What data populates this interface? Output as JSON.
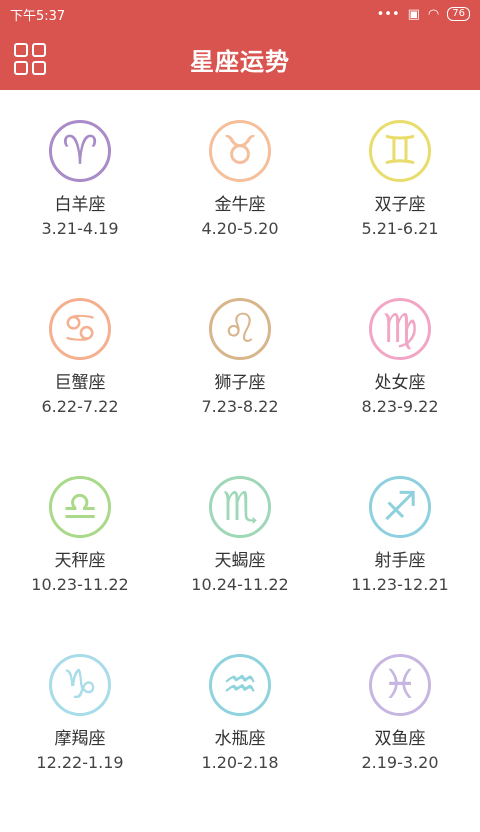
{
  "status": {
    "time": "下午5:37",
    "dots": "•••",
    "battery": "76"
  },
  "header": {
    "title": "星座运势",
    "menu_icon": "grid-menu-icon"
  },
  "signs": [
    {
      "name": "白羊座",
      "date": "3.21-4.19",
      "symbol": "♈",
      "color": "#a98bc7"
    },
    {
      "name": "金牛座",
      "date": "4.20-5.20",
      "symbol": "♉",
      "color": "#f4bf9a"
    },
    {
      "name": "双子座",
      "date": "5.21-6.21",
      "symbol": "♊",
      "color": "#e9dc6b"
    },
    {
      "name": "巨蟹座",
      "date": "6.22-7.22",
      "symbol": "♋",
      "color": "#f4b08f"
    },
    {
      "name": "狮子座",
      "date": "7.23-8.22",
      "symbol": "♌",
      "color": "#d9b58c"
    },
    {
      "name": "处女座",
      "date": "8.23-9.22",
      "symbol": "♍",
      "color": "#f2a6c6"
    },
    {
      "name": "天秤座",
      "date": "10.23-11.22",
      "symbol": "♎",
      "color": "#a9d989"
    },
    {
      "name": "天蝎座",
      "date": "10.24-11.22",
      "symbol": "♏",
      "color": "#9ed8b9"
    },
    {
      "name": "射手座",
      "date": "11.23-12.21",
      "symbol": "♐",
      "color": "#8fd0df"
    },
    {
      "name": "摩羯座",
      "date": "12.22-1.19",
      "symbol": "♑",
      "color": "#a9dce9"
    },
    {
      "name": "水瓶座",
      "date": "1.20-2.18",
      "symbol": "♒",
      "color": "#8fd3dd"
    },
    {
      "name": "双鱼座",
      "date": "2.19-3.20",
      "symbol": "♓",
      "color": "#c7b6df"
    }
  ]
}
